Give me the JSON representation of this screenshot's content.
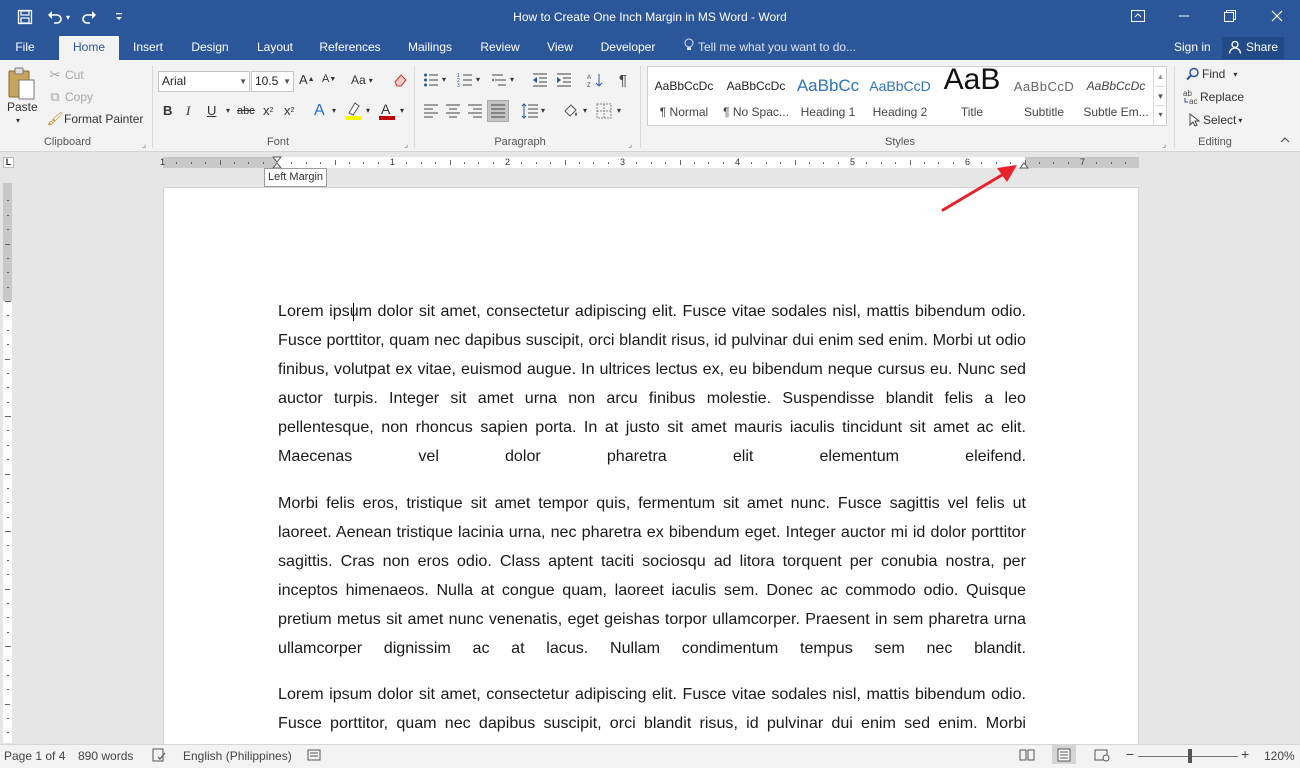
{
  "window": {
    "title": "How to Create One Inch Margin in MS Word - Word",
    "min_icon": "minimize-icon",
    "max_icon": "restore-icon",
    "close_icon": "close-icon"
  },
  "tabs": {
    "file": "File",
    "home": "Home",
    "insert": "Insert",
    "design": "Design",
    "layout": "Layout",
    "references": "References",
    "mailings": "Mailings",
    "review": "Review",
    "view": "View",
    "developer": "Developer",
    "tell_me": "Tell me what you want to do...",
    "sign_in": "Sign in",
    "share": "Share"
  },
  "clipboard": {
    "paste": "Paste",
    "cut": "Cut",
    "copy": "Copy",
    "format_painter": "Format Painter",
    "label": "Clipboard"
  },
  "font": {
    "name": "Arial",
    "size": "10.5",
    "label": "Font",
    "change_case": "Aa",
    "bold": "B",
    "italic": "I",
    "underline": "U",
    "strikethrough": "abc",
    "subscript": "x",
    "superscript": "x"
  },
  "paragraph": {
    "label": "Paragraph"
  },
  "styles": {
    "label": "Styles",
    "items": [
      {
        "preview": "AaBbCcDc",
        "name": "¶ Normal"
      },
      {
        "preview": "AaBbCcDc",
        "name": "¶ No Spac..."
      },
      {
        "preview": "AaBbCc",
        "name": "Heading 1"
      },
      {
        "preview": "AaBbCcD",
        "name": "Heading 2"
      },
      {
        "preview": "AaB",
        "name": "Title"
      },
      {
        "preview": "AaBbCcD",
        "name": "Subtitle"
      },
      {
        "preview": "AaBbCcDc",
        "name": "Subtle Em..."
      }
    ]
  },
  "editing": {
    "label": "Editing",
    "find": "Find",
    "replace": "Replace",
    "select": "Select"
  },
  "ruler": {
    "numbers": [
      "1",
      "1",
      "2",
      "3",
      "4",
      "5",
      "6",
      "7"
    ],
    "tooltip": "Left Margin",
    "tab_selector": "L"
  },
  "document": {
    "paragraphs": [
      "Lorem ipsum dolor sit amet, consectetur adipiscing elit. Fusce vitae sodales nisl, mattis bibendum odio. Fusce porttitor, quam nec dapibus suscipit, orci blandit risus, id pulvinar dui enim sed enim. Morbi ut odio finibus, volutpat ex vitae, euismod augue. In ultrices lectus ex, eu bibendum neque cursus eu. Nunc sed auctor turpis. Integer sit amet urna non arcu finibus molestie. Suspendisse blandit felis a leo pellentesque, non rhoncus sapien porta. In at justo sit amet mauris iaculis tincidunt sit amet ac elit. Maecenas vel dolor pharetra elit elementum eleifend.",
      "Morbi felis eros, tristique sit amet tempor quis, fermentum sit amet nunc. Fusce sagittis vel felis ut laoreet. Aenean tristique lacinia urna, nec pharetra ex bibendum eget. Integer auctor mi id dolor porttitor sagittis. Cras non eros odio. Class aptent taciti sociosqu ad litora torquent per conubia nostra, per inceptos himenaeos. Nulla at congue quam, laoreet iaculis sem. Donec ac commodo odio. Quisque pretium metus sit amet nunc venenatis, eget geishas torpor ullamcorper. Praesent in sem pharetra urna ullamcorper dignissim ac at lacus. Nullam condimentum tempus sem nec blandit.",
      "Lorem ipsum dolor sit amet, consectetur adipiscing elit. Fusce vitae sodales nisl, mattis bibendum odio. Fusce porttitor, quam nec dapibus suscipit, orci blandit risus, id pulvinar dui enim sed enim. Morbi"
    ]
  },
  "status": {
    "page": "Page 1 of 4",
    "words": "890 words",
    "language": "English (Philippines)",
    "zoom": "120%"
  },
  "colors": {
    "brand": "#2b579a",
    "arrow": "#e8212a",
    "font_color": "#c00000",
    "highlight": "#ffff00"
  }
}
